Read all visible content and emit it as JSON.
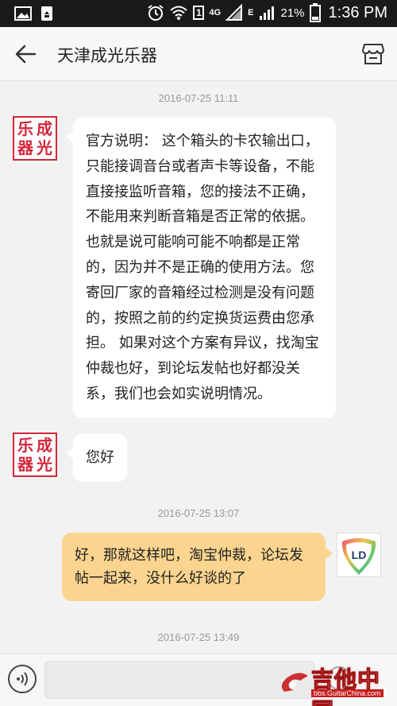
{
  "status_bar": {
    "network": "4G",
    "sim": "1",
    "edge": "E",
    "battery_pct": "21%",
    "time": "1:36 PM"
  },
  "header": {
    "title": "天津成光乐器"
  },
  "conversation": {
    "seller_avatar_glyphs": [
      "乐",
      "成",
      "器",
      "光"
    ],
    "user_avatar_text": "LD",
    "messages": [
      {
        "timestamp": "2016-07-25 11:11",
        "from": "seller",
        "text": "官方说明：  这个箱头的卡农输出口，只能接调音台或者声卡等设备，不能直接接监听音箱，您的接法不正确，不能用来判断音箱是否正常的依据。      也就是说可能响可能不响都是正常的，因为并不是正确的使用方法。您寄回厂家的音箱经过检测是没有问题的，按照之前的约定换货运费由您承担。       如果对这个方案有异议，找淘宝仲裁也好，到论坛发帖也好都没关系，我们也会如实说明情况。"
      },
      {
        "from": "seller",
        "text": "您好"
      },
      {
        "timestamp": "2016-07-25 13:07",
        "from": "user",
        "text": "好，那就这样吧，淘宝仲裁，论坛发帖一起来，没什么好谈的了"
      },
      {
        "timestamp": "2016-07-25 13:49"
      }
    ]
  },
  "input_bar": {
    "value": "",
    "placeholder": ""
  },
  "watermark": {
    "text": "吉他中国",
    "url": "bbs.GuitarChina.com"
  },
  "colors": {
    "outgoing_bubble": "#fbd58f",
    "seller_brand": "#d3263a"
  }
}
